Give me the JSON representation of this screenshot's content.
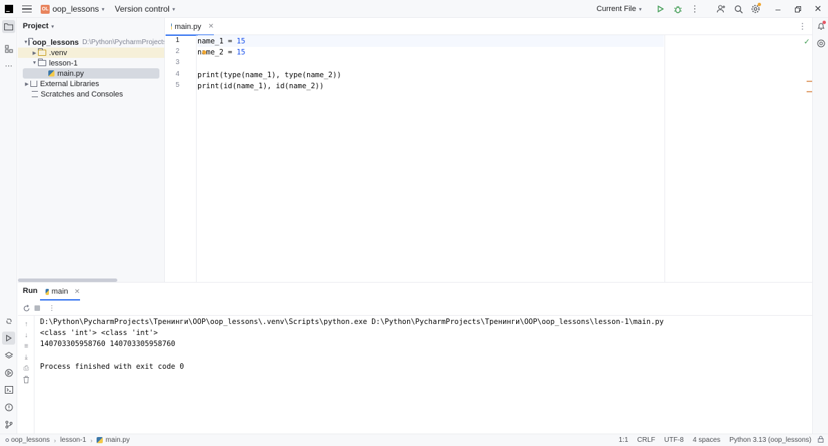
{
  "titlebar": {
    "project_badge": "OL",
    "project_name": "oop_lessons",
    "vcs_label": "Version control",
    "run_config": "Current File"
  },
  "project_panel": {
    "title": "Project",
    "root_name": "oop_lessons",
    "root_path": "D:\\Python\\PycharmProjects\\Тре",
    "venv": ".venv",
    "lesson_folder": "lesson-1",
    "file": "main.py",
    "external_libraries": "External Libraries",
    "scratches": "Scratches and Consoles"
  },
  "editor": {
    "tab_label": "main.py",
    "line_numbers": [
      "1",
      "2",
      "3",
      "4",
      "5"
    ],
    "lines": [
      {
        "pre": "name_1 = ",
        "num": "15"
      },
      {
        "pre": "name_2 = ",
        "num": "15"
      },
      {
        "pre": "",
        "num": ""
      },
      {
        "pre": "print(type(name_1), type(name_2))",
        "num": ""
      },
      {
        "pre": "print(id(name_1), id(name_2))",
        "num": ""
      }
    ]
  },
  "run_panel": {
    "title": "Run",
    "tab_label": "main",
    "output": [
      "D:\\Python\\PycharmProjects\\Тренинги\\OOP\\oop_lessons\\.venv\\Scripts\\python.exe D:\\Python\\PycharmProjects\\Тренинги\\OOP\\oop_lessons\\lesson-1\\main.py",
      "<class 'int'> <class 'int'>",
      "140703305958760 140703305958760",
      "",
      "Process finished with exit code 0"
    ]
  },
  "statusbar": {
    "crumbs": [
      "oop_lessons",
      "lesson-1",
      "main.py"
    ],
    "position": "1:1",
    "line_separator": "CRLF",
    "encoding": "UTF-8",
    "indent": "4 spaces",
    "interpreter": "Python 3.13 (oop_lessons)"
  },
  "icons": {
    "app": "pycharm-logo-icon",
    "run": "run-icon",
    "debug": "debug-icon",
    "search": "search-icon",
    "settings": "gear-icon"
  },
  "colors": {
    "accent": "#3574f0",
    "number": "#1750eb",
    "project_badge": "#e8845e",
    "run_green": "#3d9a50"
  }
}
